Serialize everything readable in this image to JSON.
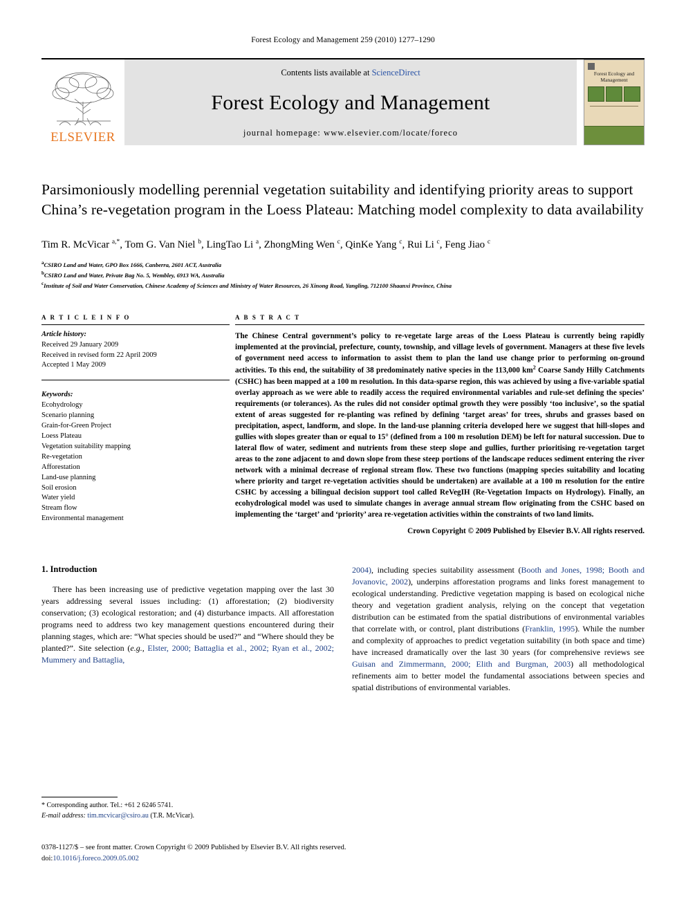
{
  "running_head": "Forest Ecology and Management 259 (2010) 1277–1290",
  "masthead": {
    "publisher": "ELSEVIER",
    "contents_prefix": "Contents lists available at",
    "contents_link": "ScienceDirect",
    "journal_title": "Forest Ecology and Management",
    "homepage": "journal homepage: www.elsevier.com/locate/foreco",
    "cover_title": "Forest Ecology and Management"
  },
  "article": {
    "title": "Parsimoniously modelling perennial vegetation suitability and identifying priority areas to support China’s re-vegetation program in the Loess Plateau: Matching model complexity to data availability",
    "authors": "Tim R. McVicar a,*, Tom G. Van Niel b, LingTao Li a, ZhongMing Wen c, QinKe Yang c, Rui Li c, Feng Jiao c",
    "affiliations": [
      {
        "marker": "a",
        "text": "CSIRO Land and Water, GPO Box 1666, Canberra, 2601 ACT, Australia"
      },
      {
        "marker": "b",
        "text": "CSIRO Land and Water, Private Bag No. 5, Wembley, 6913 WA, Australia"
      },
      {
        "marker": "c",
        "text": "Institute of Soil and Water Conservation, Chinese Academy of Sciences and Ministry of Water Resources, 26 Xinong Road, Yangling, 712100 Shaanxi Province, China"
      }
    ]
  },
  "info": {
    "label": "A R T I C L E   I N F O",
    "history_heading": "Article history:",
    "history": [
      "Received 29 January 2009",
      "Received in revised form 22 April 2009",
      "Accepted 1 May 2009"
    ],
    "keywords_heading": "Keywords:",
    "keywords": [
      "Ecohydrology",
      "Scenario planning",
      "Grain-for-Green Project",
      "Loess Plateau",
      "Vegetation suitability mapping",
      "Re-vegetation",
      "Afforestation",
      "Land-use planning",
      "Soil erosion",
      "Water yield",
      "Stream flow",
      "Environmental management"
    ]
  },
  "abstract": {
    "label": "A B S T R A C T",
    "part1": "The Chinese Central government’s policy to re-vegetate large areas of the Loess Plateau is currently being rapidly implemented at the provincial, prefecture, county, township, and village levels of government. Managers at these five levels of government need access to information to assist them to plan the land use change prior to performing on-ground activities. To this end, the suitability of 38 predominately native species in the 113,000 km",
    "sup1": "2",
    "part2": " Coarse Sandy Hilly Catchments (CSHC) has been mapped at a 100 m resolution. In this data-sparse region, this was achieved by using a five-variable spatial overlay approach as we were able to readily access the required environmental variables and rule-set defining the species’ requirements (or tolerances). As the rules did not consider optimal growth they were possibly ‘too inclusive’, so the spatial extent of areas suggested for re-planting was refined by defining ‘target areas’ for trees, shrubs and grasses based on precipitation, aspect, landform, and slope. In the land-use planning criteria developed here we suggest that hill-slopes and gullies with slopes greater than or equal to 15° (defined from a 100 m resolution DEM) be left for natural succession. Due to lateral flow of water, sediment and nutrients from these steep slope and gullies, further prioritising re-vegetation target areas to the zone adjacent to and down slope from these steep portions of the landscape reduces sediment entering the river network with a minimal decrease of regional stream flow. These two functions (mapping species suitability and locating where priority and target re-vegetation activities should be undertaken) are available at a 100 m resolution for the entire CSHC by accessing a bilingual decision support tool called ReVegIH (Re-Vegetation Impacts on Hydrology). Finally, an ecohydrological model was used to simulate changes in average annual stream flow originating from the CSHC based on implementing the ‘target’ and ‘priority’ area re-vegetation activities within the constraints of two land limits.",
    "copyright": "Crown Copyright © 2009 Published by Elsevier B.V. All rights reserved."
  },
  "introduction": {
    "heading": "1.  Introduction",
    "left_p1": "There has been increasing use of predictive vegetation mapping over the last 30 years addressing several issues including: (1) afforestation; (2) biodiversity conservation; (3) ecological restoration; and (4) disturbance impacts. All afforestation programs need to address two key management questions encountered during their planning stages, which are: “What species should be used?” and “Where should they be planted?”. Site selection (",
    "left_eg": "e.g.,",
    "left_cite1": " Elster, 2000; Battaglia et al., 2002; Ryan et al., 2002; Mummery and Battaglia,",
    "right_cite_open": "2004)",
    "right_p1a": ", including species suitability assessment (",
    "right_cite2": "Booth and Jones, 1998; Booth and Jovanovic, 2002",
    "right_p1b": "), underpins afforestation programs and links forest management to ecological understanding. Predictive vegetation mapping is based on ecological niche theory and vegetation gradient analysis, relying on the concept that vegetation distribution can be estimated from the spatial distributions of environmental variables that correlate with, or control, plant distributions (",
    "right_cite3": "Franklin, 1995",
    "right_p1c": "). While the number and complexity of approaches to predict vegetation suitability (in both space and time) have increased dramatically over the last 30 years (for comprehensive reviews see ",
    "right_cite4": "Guisan and Zimmermann, 2000; Elith and Burgman, 2003",
    "right_p1d": ") all methodological refinements aim to better model the fundamental associations between species and spatial distributions of environmental variables."
  },
  "footnotes": {
    "corresponding": "*  Corresponding author. Tel.: +61 2 6246 5741.",
    "email_label": "E-mail address:",
    "email": "tim.mcvicar@csiro.au",
    "email_suffix": " (T.R. McVicar)."
  },
  "imprint": {
    "front_matter": "0378-1127/$ – see front matter. Crown Copyright © 2009 Published by Elsevier B.V. All rights reserved.",
    "doi_label": "doi:",
    "doi": "10.1016/j.foreco.2009.05.002"
  }
}
